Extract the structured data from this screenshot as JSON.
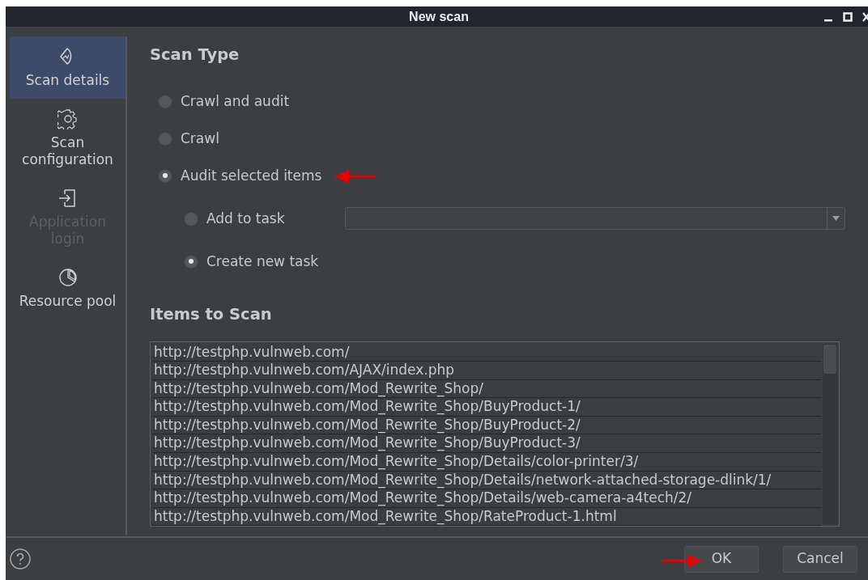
{
  "window": {
    "title": "New scan"
  },
  "sidebar": {
    "items": [
      {
        "label": "Scan details",
        "kind": "scan",
        "selected": true,
        "disabled": false
      },
      {
        "label": "Scan configuration",
        "kind": "gear",
        "selected": false,
        "disabled": false
      },
      {
        "label": "Application login",
        "kind": "login",
        "selected": false,
        "disabled": true
      },
      {
        "label": "Resource pool",
        "kind": "pie",
        "selected": false,
        "disabled": false
      }
    ]
  },
  "scan_type": {
    "heading": "Scan Type",
    "options": [
      {
        "label": "Crawl and audit",
        "selected": false
      },
      {
        "label": "Crawl",
        "selected": false
      },
      {
        "label": "Audit selected items",
        "selected": true,
        "children": [
          {
            "label": "Add to task",
            "selected": false,
            "has_dropdown": true
          },
          {
            "label": "Create new task",
            "selected": true
          }
        ]
      }
    ]
  },
  "items_to_scan": {
    "heading": "Items to Scan",
    "rows": [
      "http://testphp.vulnweb.com/",
      "http://testphp.vulnweb.com/AJAX/index.php",
      "http://testphp.vulnweb.com/Mod_Rewrite_Shop/",
      "http://testphp.vulnweb.com/Mod_Rewrite_Shop/BuyProduct-1/",
      "http://testphp.vulnweb.com/Mod_Rewrite_Shop/BuyProduct-2/",
      "http://testphp.vulnweb.com/Mod_Rewrite_Shop/BuyProduct-3/",
      "http://testphp.vulnweb.com/Mod_Rewrite_Shop/Details/color-printer/3/",
      "http://testphp.vulnweb.com/Mod_Rewrite_Shop/Details/network-attached-storage-dlink/1/",
      "http://testphp.vulnweb.com/Mod_Rewrite_Shop/Details/web-camera-a4tech/2/",
      "http://testphp.vulnweb.com/Mod_Rewrite_Shop/RateProduct-1.html"
    ]
  },
  "buttons": [
    {
      "label": "OK",
      "kind": "primary"
    },
    {
      "label": "Cancel",
      "kind": "secondary"
    }
  ]
}
